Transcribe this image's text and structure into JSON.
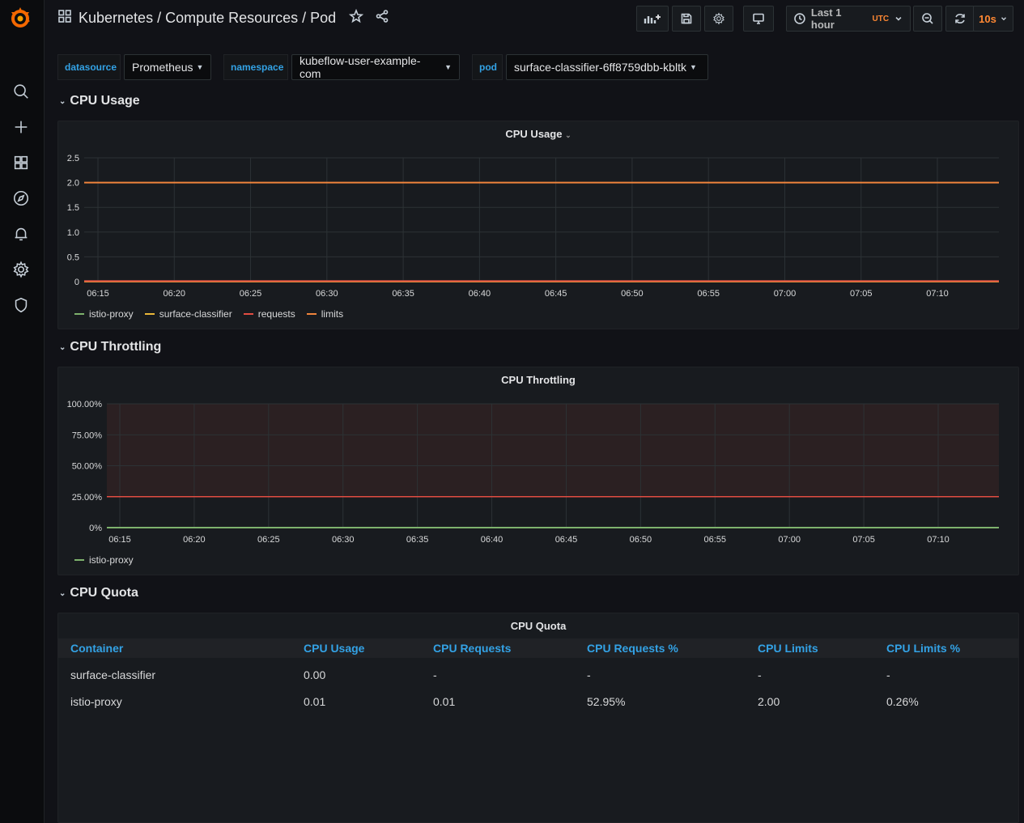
{
  "header": {
    "breadcrumb": "Kubernetes / Compute Resources / Pod",
    "time_range": "Last 1 hour",
    "timezone": "UTC",
    "refresh_interval": "10s"
  },
  "variables": [
    {
      "label": "datasource",
      "value": "Prometheus"
    },
    {
      "label": "namespace",
      "value": "kubeflow-user-example-com"
    },
    {
      "label": "pod",
      "value": "surface-classifier-6ff8759dbb-kbltk"
    }
  ],
  "rows": {
    "cpu_usage": "CPU Usage",
    "cpu_throttling": "CPU Throttling",
    "cpu_quota": "CPU Quota"
  },
  "colors": {
    "istio_proxy": "#7eb26d",
    "surface_classifier": "#eab839",
    "requests": "#e24d42",
    "limits": "#ef843c",
    "throttle_threshold": "#e24d42",
    "accent": "#33a2e5"
  },
  "panels": {
    "cpu_usage": {
      "title": "CPU Usage",
      "legend": [
        "istio-proxy",
        "surface-classifier",
        "requests",
        "limits"
      ]
    },
    "cpu_throttling": {
      "title": "CPU Throttling",
      "legend": [
        "istio-proxy"
      ]
    },
    "cpu_quota": {
      "title": "CPU Quota",
      "columns": [
        "Container",
        "CPU Usage",
        "CPU Requests",
        "CPU Requests %",
        "CPU Limits",
        "CPU Limits %"
      ],
      "rows": [
        [
          "surface-classifier",
          "0.00",
          "-",
          "-",
          "-",
          "-"
        ],
        [
          "istio-proxy",
          "0.01",
          "0.01",
          "52.95%",
          "2.00",
          "0.26%"
        ]
      ]
    }
  },
  "chart_data": [
    {
      "type": "line",
      "title": "CPU Usage",
      "x": [
        "06:15",
        "06:20",
        "06:25",
        "06:30",
        "06:35",
        "06:40",
        "06:45",
        "06:50",
        "06:55",
        "07:00",
        "07:05",
        "07:10"
      ],
      "yticks": [
        "0",
        "0.5",
        "1.0",
        "1.5",
        "2.0",
        "2.5"
      ],
      "ylim": [
        0,
        2.5
      ],
      "series": [
        {
          "name": "istio-proxy",
          "values": [
            0.01,
            0.01,
            0.01,
            0.01,
            0.01,
            0.01,
            0.01,
            0.01,
            0.01,
            0.01,
            0.01,
            0.01
          ]
        },
        {
          "name": "surface-classifier",
          "values": [
            0,
            0,
            0,
            0,
            0,
            0,
            0,
            0,
            0,
            0,
            0,
            0
          ]
        },
        {
          "name": "requests",
          "values": [
            0.01,
            0.01,
            0.01,
            0.01,
            0.01,
            0.01,
            0.01,
            0.01,
            0.01,
            0.01,
            0.01,
            0.01
          ]
        },
        {
          "name": "limits",
          "values": [
            2.0,
            2.0,
            2.0,
            2.0,
            2.0,
            2.0,
            2.0,
            2.0,
            2.0,
            2.0,
            2.0,
            2.0
          ]
        }
      ],
      "grid": true,
      "legend": "bottom-left"
    },
    {
      "type": "line",
      "title": "CPU Throttling",
      "x": [
        "06:15",
        "06:20",
        "06:25",
        "06:30",
        "06:35",
        "06:40",
        "06:45",
        "06:50",
        "06:55",
        "07:00",
        "07:05",
        "07:10"
      ],
      "yticks": [
        "0%",
        "25.00%",
        "50.00%",
        "75.00%",
        "100.00%"
      ],
      "ylim": [
        0,
        100
      ],
      "threshold": 25,
      "series": [
        {
          "name": "istio-proxy",
          "values": [
            0,
            0,
            0,
            0,
            0,
            0,
            0,
            0,
            0,
            0,
            0,
            0
          ]
        }
      ],
      "grid": true,
      "legend": "bottom-left"
    }
  ]
}
